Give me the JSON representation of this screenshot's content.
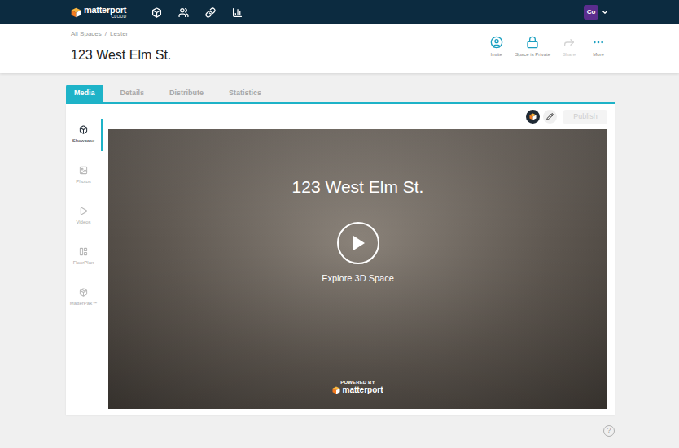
{
  "nav": {
    "logo": "matterport",
    "logo_sub": "CLOUD",
    "avatar": "Co"
  },
  "breadcrumb": {
    "items": [
      "All Spaces",
      "Lester"
    ],
    "separator": "/"
  },
  "title": "123 West Elm St.",
  "actions": [
    {
      "label": "Invite",
      "disabled": false
    },
    {
      "label": "Space is Private",
      "disabled": false
    },
    {
      "label": "Share",
      "disabled": true
    },
    {
      "label": "More",
      "disabled": false
    }
  ],
  "tabs": [
    {
      "label": "Media",
      "selected": true
    },
    {
      "label": "Details",
      "selected": false
    },
    {
      "label": "Distribute",
      "selected": false
    },
    {
      "label": "Statistics",
      "selected": false
    }
  ],
  "sidebar": [
    {
      "label": "Showcase",
      "selected": true
    },
    {
      "label": "Photos",
      "selected": false
    },
    {
      "label": "Videos",
      "selected": false
    },
    {
      "label": "FloorPlan",
      "selected": false
    },
    {
      "label": "MatterPak™",
      "selected": false
    }
  ],
  "publish": {
    "label": "Publish",
    "disabled": true
  },
  "showcase": {
    "title": "123 West Elm St.",
    "cta": "Explore 3D Space",
    "powered_by": "POWERED BY",
    "brand": "matterport"
  },
  "help": "?"
}
